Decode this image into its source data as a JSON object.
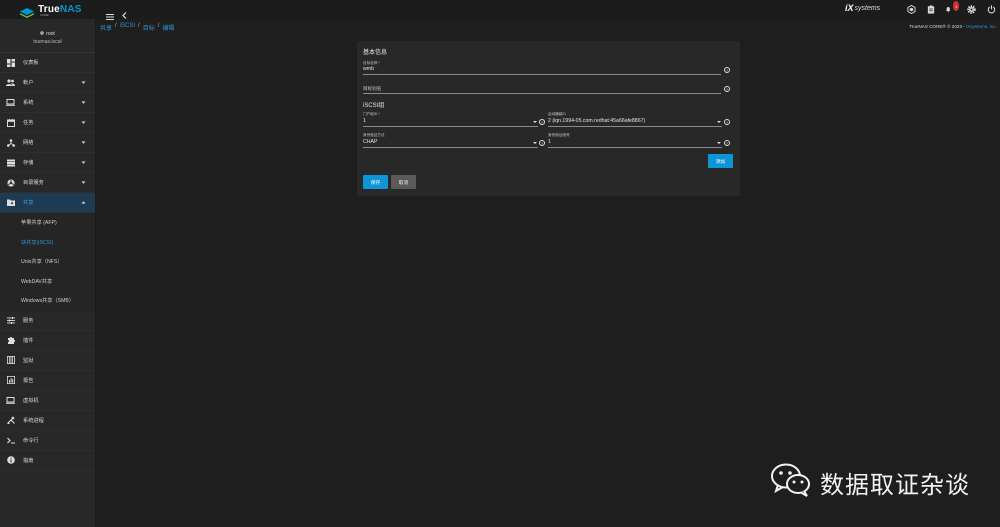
{
  "app": {
    "logo_text_1": "True",
    "logo_text_2": "NAS",
    "logo_sub": "CORE",
    "brand_ix": "iX",
    "brand_systems": "systems",
    "notification_count": "1",
    "copyright_prefix": "TrueNAS CORE® © 2023 - ",
    "copyright_company": "iXsystems, Inc."
  },
  "user": {
    "name": "root",
    "host": "truenas.local"
  },
  "sidebar": {
    "items": [
      {
        "label": "仪表板",
        "icon": "dashboard-icon"
      },
      {
        "label": "帐户",
        "icon": "accounts-icon"
      },
      {
        "label": "系统",
        "icon": "system-icon"
      },
      {
        "label": "任务",
        "icon": "tasks-icon"
      },
      {
        "label": "网络",
        "icon": "network-icon"
      },
      {
        "label": "存储",
        "icon": "storage-icon"
      },
      {
        "label": "目录服务",
        "icon": "directory-services-icon"
      },
      {
        "label": "共享",
        "icon": "sharing-icon"
      },
      {
        "label": "服务",
        "icon": "services-icon"
      },
      {
        "label": "插件",
        "icon": "plugins-icon"
      },
      {
        "label": "监狱",
        "icon": "jails-icon"
      },
      {
        "label": "报告",
        "icon": "reporting-icon"
      },
      {
        "label": "虚拟机",
        "icon": "vm-icon"
      },
      {
        "label": "系统进程",
        "icon": "processes-icon"
      },
      {
        "label": "命令行",
        "icon": "shell-icon"
      },
      {
        "label": "指南",
        "icon": "guide-icon"
      }
    ],
    "sharing_sub": [
      "苹果共享 (AFP)",
      "块共享(iSCSI)",
      "Unix共享（NFS）",
      "WebDAV共享",
      "Windows共享（SMB）"
    ]
  },
  "breadcrumb": [
    "共享",
    "iSCSI",
    "目标",
    "编辑"
  ],
  "form": {
    "basic_title": "基本信息",
    "target_name_label": "目标名称 *",
    "target_name_value": "wmb",
    "target_alias_label": "目标别名",
    "target_alias_value": "",
    "group_title": "iSCSI组",
    "portal_label": "门户组ID *",
    "portal_value": "1",
    "initiator_label": "启动器组ID",
    "initiator_value": "2 (iqn.1994-05.com.redhat:45a66afe8867)",
    "auth_method_label": "身份验证方法",
    "auth_method_value": "CHAP",
    "auth_group_label": "身份验证组号",
    "auth_group_value": "1",
    "add_label": "添加",
    "save_label": "保存",
    "cancel_label": "取消",
    "help_glyph": "?"
  },
  "watermark": {
    "text": "数据取证杂谈"
  },
  "colors": {
    "accent": "#0d95d6",
    "sidebar_bg": "#282828",
    "page_bg": "#1e1e1e",
    "active_nav_bg": "#1f3b52",
    "badge": "#d32f2f"
  }
}
